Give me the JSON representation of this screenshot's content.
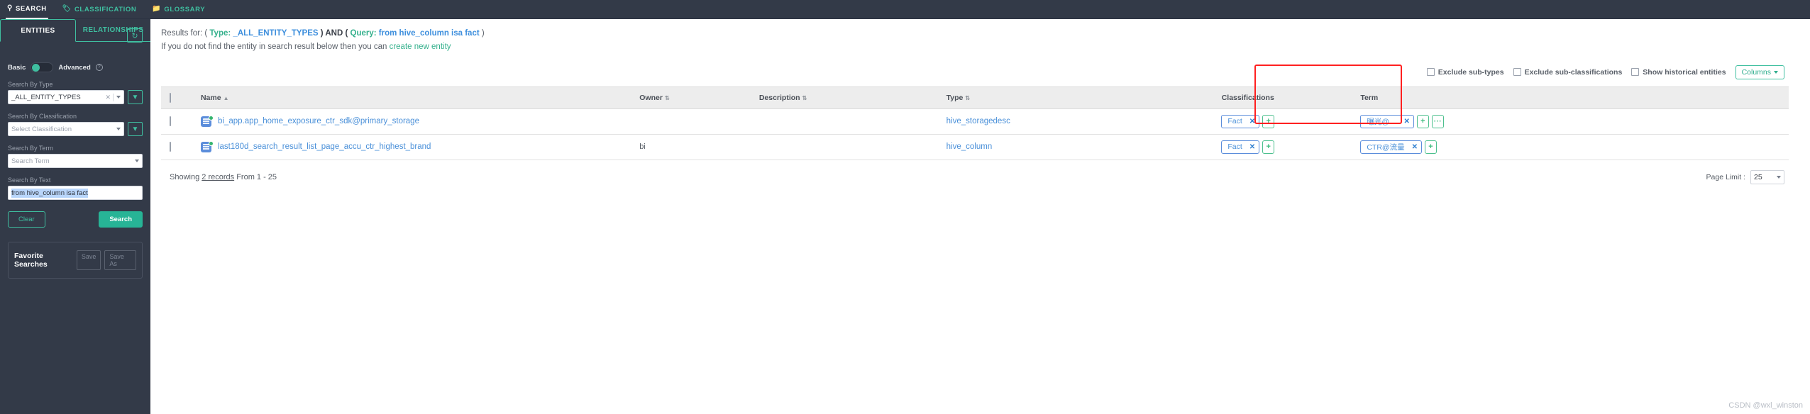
{
  "topnav": {
    "items": [
      {
        "label": "SEARCH",
        "icon": "search-icon",
        "glyph": "⌕",
        "active": true
      },
      {
        "label": "CLASSIFICATION",
        "icon": "tag-icon",
        "glyph": "🏷",
        "active": false
      },
      {
        "label": "GLOSSARY",
        "icon": "folder-icon",
        "glyph": "📁",
        "active": false
      }
    ]
  },
  "sidebar": {
    "tabs": [
      {
        "label": "ENTITIES",
        "active": true
      },
      {
        "label": "RELATIONSHIPS",
        "active": false
      }
    ],
    "mode_toggle": {
      "basic_label": "Basic",
      "advanced_label": "Advanced",
      "help_glyph": "?",
      "state": "basic"
    },
    "refresh_icon": "↻",
    "fields": [
      {
        "label": "Search By Type",
        "value": "_ALL_ENTITY_TYPES",
        "is_placeholder": false,
        "has_clear": true,
        "has_filter": true,
        "filter_glyph": "▼"
      },
      {
        "label": "Search By Classification",
        "value": "Select Classification",
        "is_placeholder": true,
        "has_clear": false,
        "has_filter": true,
        "filter_glyph": "▼"
      },
      {
        "label": "Search By Term",
        "value": "Search Term",
        "is_placeholder": true,
        "has_clear": false,
        "has_filter": false,
        "filter_glyph": ""
      }
    ],
    "text_field": {
      "label": "Search By Text",
      "value": "from hive_column isa fact"
    },
    "buttons": {
      "clear": "Clear",
      "search": "Search"
    },
    "favorites": {
      "title": "Favorite Searches",
      "save": "Save",
      "save_as": "Save As"
    }
  },
  "results": {
    "prefix": "Results for: (",
    "type_key": "Type:",
    "type_value": "_ALL_ENTITY_TYPES",
    "mid": ") AND (",
    "query_key": "Query:",
    "query_value": "from hive_column isa fact",
    "suffix": ")",
    "hint_text": "If you do not find the entity in search result below then you can",
    "hint_link": "create new entity"
  },
  "options": {
    "exclude_subtypes": "Exclude sub-types",
    "exclude_subclassifications": "Exclude sub-classifications",
    "show_historical": "Show historical entities",
    "columns_button": "Columns"
  },
  "table": {
    "columns": [
      {
        "key": "check",
        "label": "",
        "sortable": false
      },
      {
        "key": "name",
        "label": "Name",
        "sortable": true,
        "sort_dir": "asc"
      },
      {
        "key": "owner",
        "label": "Owner",
        "sortable": true,
        "sort_dir": "none"
      },
      {
        "key": "description",
        "label": "Description",
        "sortable": true,
        "sort_dir": "none"
      },
      {
        "key": "type",
        "label": "Type",
        "sortable": true,
        "sort_dir": "none"
      },
      {
        "key": "classifications",
        "label": "Classifications",
        "sortable": false
      },
      {
        "key": "term",
        "label": "Term",
        "sortable": false
      }
    ],
    "rows": [
      {
        "name": "bi_app.app_home_exposure_ctr_sdk@primary_storage",
        "owner": "",
        "description": "",
        "type": "hive_storagedesc",
        "classifications": [
          {
            "label": "Fact"
          }
        ],
        "classification_add": "+",
        "terms": [
          {
            "label": "曝光@…"
          }
        ],
        "term_add": "+",
        "term_more": "···"
      },
      {
        "name": "last180d_search_result_list_page_accu_ctr_highest_brand",
        "owner": "bi",
        "description": "",
        "type": "hive_column",
        "classifications": [
          {
            "label": "Fact"
          }
        ],
        "classification_add": "+",
        "terms": [
          {
            "label": "CTR@流量"
          }
        ],
        "term_add": "+",
        "term_more": ""
      }
    ]
  },
  "footer": {
    "showing_prefix": "Showing",
    "record_count": "2 records",
    "range": "From 1 - 25",
    "page_limit_label": "Page Limit :",
    "page_limit_value": "25"
  },
  "watermark": "CSDN @wxl_winston",
  "colors": {
    "sidebar_bg": "#333a48",
    "accent_green": "#3fbfa0",
    "link_blue": "#4a90d9",
    "highlight_red": "#ff2020"
  }
}
